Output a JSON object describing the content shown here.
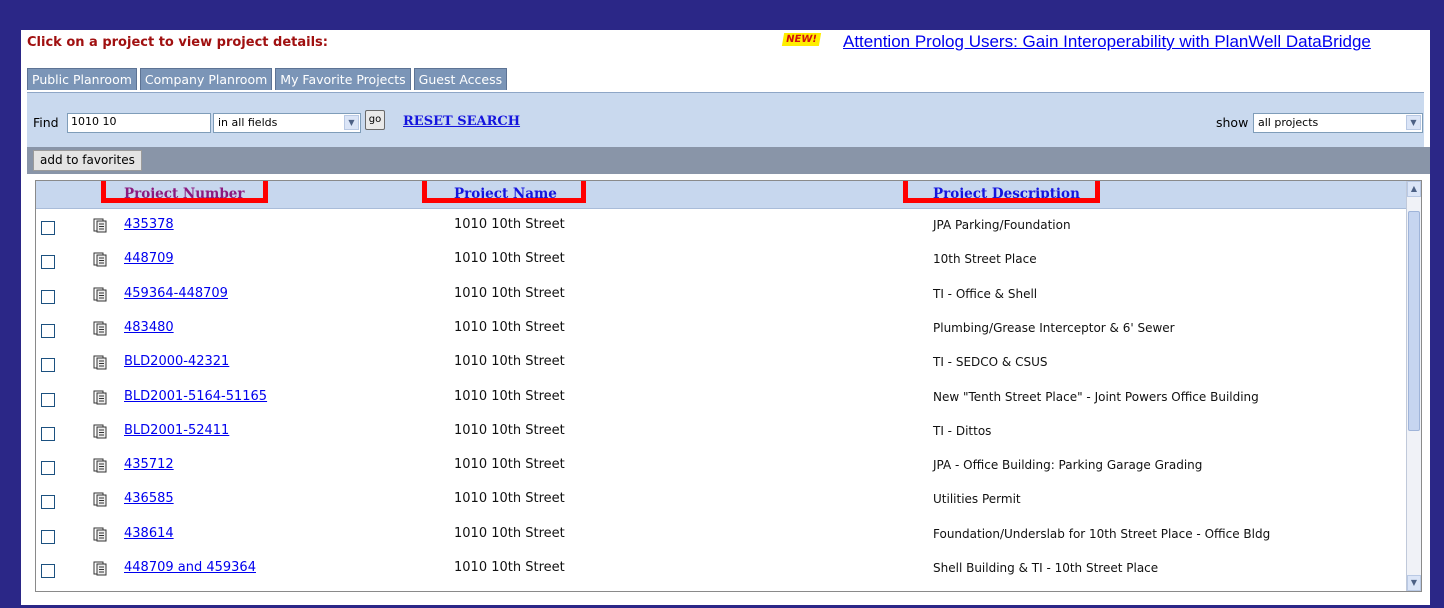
{
  "header": {
    "instruction": "Click on a project to view project details:",
    "new_badge": "NEW!",
    "announcement": "Attention Prolog Users: Gain Interoperability with PlanWell DataBridge"
  },
  "tabs": [
    {
      "label": "Public Planroom"
    },
    {
      "label": "Company Planroom"
    },
    {
      "label": "My Favorite Projects"
    },
    {
      "label": "Guest Access"
    }
  ],
  "search": {
    "find_label": "Find",
    "find_value": "1010 10",
    "field_option": "in all fields",
    "go_label": "go",
    "reset_label": "RESET SEARCH",
    "show_label": "show",
    "show_option": "all projects"
  },
  "toolbar": {
    "add_favorites_label": "add to favorites"
  },
  "table": {
    "columns": {
      "number": "Project Number",
      "name": "Project Name",
      "description": "Project Description"
    },
    "rows": [
      {
        "number": "435378",
        "name": "1010 10th Street",
        "description": "JPA Parking/Foundation"
      },
      {
        "number": "448709",
        "name": "1010 10th Street",
        "description": "10th Street Place"
      },
      {
        "number": "459364-448709",
        "name": "1010 10th Street",
        "description": "TI - Office & Shell"
      },
      {
        "number": "483480",
        "name": "1010 10th Street",
        "description": "Plumbing/Grease Interceptor & 6' Sewer"
      },
      {
        "number": "BLD2000-42321",
        "name": "1010 10th Street",
        "description": "TI - SEDCO & CSUS"
      },
      {
        "number": "BLD2001-5164-51165",
        "name": "1010 10th Street",
        "description": "New \"Tenth Street Place\" - Joint Powers Office Building"
      },
      {
        "number": "BLD2001-52411",
        "name": "1010 10th Street",
        "description": "TI - Dittos"
      },
      {
        "number": "435712",
        "name": "1010 10th Street",
        "description": "JPA - Office Building: Parking Garage Grading"
      },
      {
        "number": "436585",
        "name": "1010 10th Street",
        "description": "Utilities Permit"
      },
      {
        "number": "438614",
        "name": "1010 10th Street",
        "description": "Foundation/Underslab for 10th Street Place - Office Bldg"
      },
      {
        "number": "448709 and 459364",
        "name": "1010 10th Street",
        "description": "Shell Building & TI - 10th Street Place"
      }
    ]
  },
  "colors": {
    "page_background": "#2b2787",
    "tab_fill": "#7b95b7",
    "link": "#0000ee",
    "highlight": "#ff0000",
    "instruction_text": "#a01010"
  }
}
